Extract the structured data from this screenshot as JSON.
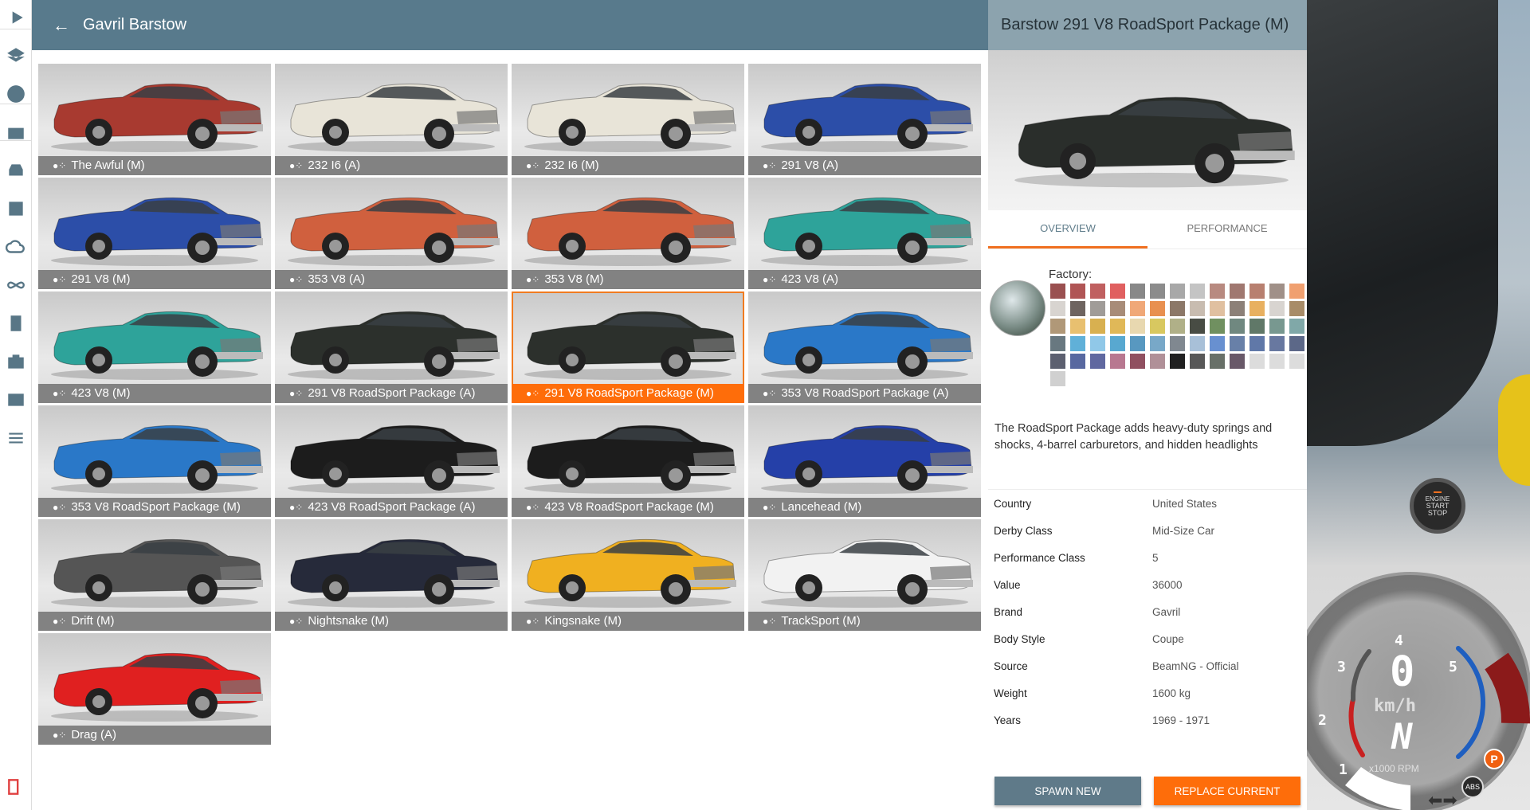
{
  "sidebar": {
    "items": [
      "play",
      "layers",
      "help",
      "scenarios",
      "vehicles",
      "vehicle-config",
      "cloud",
      "environment-infinity",
      "replay-film",
      "photo-camera",
      "ui-apps",
      "options-sliders",
      "exit"
    ]
  },
  "header": {
    "back_icon": "arrow-left-icon",
    "title": "Gavril Barstow"
  },
  "tiles": [
    {
      "label": "The Awful (M)",
      "color": "#a83a30"
    },
    {
      "label": "232 I6 (A)",
      "color": "#e8e4d8"
    },
    {
      "label": "232 I6 (M)",
      "color": "#e8e4d8"
    },
    {
      "label": "291 V8 (A)",
      "color": "#2c4ea8"
    },
    {
      "label": "291 V8 (M)",
      "color": "#2c4ea8"
    },
    {
      "label": "353 V8 (A)",
      "color": "#d0603e"
    },
    {
      "label": "353 V8 (M)",
      "color": "#d0603e"
    },
    {
      "label": "423 V8 (A)",
      "color": "#2ea39a"
    },
    {
      "label": "423 V8 (M)",
      "color": "#2ea39a"
    },
    {
      "label": "291 V8 RoadSport Package (A)",
      "color": "#2c302c"
    },
    {
      "label": "291 V8 RoadSport Package (M)",
      "color": "#2c302c",
      "selected": true
    },
    {
      "label": "353 V8 RoadSport Package (A)",
      "color": "#2a78c8"
    },
    {
      "label": "353 V8 RoadSport Package (M)",
      "color": "#2a78c8"
    },
    {
      "label": "423 V8 RoadSport Package (A)",
      "color": "#1c1c1c"
    },
    {
      "label": "423 V8 RoadSport Package (M)",
      "color": "#1c1c1c"
    },
    {
      "label": "Lancehead (M)",
      "color": "#2540a8"
    },
    {
      "label": "Drift (M)",
      "color": "#555555"
    },
    {
      "label": "Nightsnake (M)",
      "color": "#262a3a"
    },
    {
      "label": "Kingsnake (M)",
      "color": "#f0b020"
    },
    {
      "label": "TrackSport (M)",
      "color": "#f2f2f2"
    },
    {
      "label": "Drag (A)",
      "color": "#e02020"
    }
  ],
  "detail": {
    "title": "Barstow 291 V8 RoadSport Package (M)",
    "body_color": "#2a2e2b",
    "tabs": [
      "OVERVIEW",
      "PERFORMANCE"
    ],
    "paint_label": "Factory:",
    "swatches": [
      "#9a5050",
      "#b05555",
      "#c06060",
      "#e06060",
      "#888888",
      "#8c8c8c",
      "#a8a8a8",
      "#c4c4c4",
      "#b88a80",
      "#a07870",
      "#b88070",
      "#a09088",
      "#f0a070",
      "#d8d4d0",
      "#6e6460",
      "#a09c98",
      "#a88c78",
      "#f0a878",
      "#e89050",
      "#8c7868",
      "#c8bcb0",
      "#e0c0a0",
      "#8c8078",
      "#e8b060",
      "#d8d4d0",
      "#a88c68",
      "#b09878",
      "#e8c070",
      "#d8b050",
      "#e0b858",
      "#e8d8b0",
      "#d8c860",
      "#b0b088",
      "#484c44",
      "#709060",
      "#708880",
      "#607868",
      "#789890",
      "#80a8a8",
      "#687880",
      "#60b0d8",
      "#90c8e8",
      "#58a8d0",
      "#5898c0",
      "#78a8c8",
      "#808890",
      "#a8c0d8",
      "#6890d0",
      "#6880a8",
      "#6078a8",
      "#6878a0",
      "#5c6888",
      "#5c6070",
      "#5868a0",
      "#6068a0",
      "#b87890",
      "#905060",
      "#b09098",
      "#202020",
      "#585858",
      "#687068",
      "#685868",
      "#dcdcdc",
      "#dcdcdc",
      "#dcdcdc",
      "#d0d0d0"
    ],
    "description": "The RoadSport Package adds heavy-duty springs and shocks, 4-barrel carburetors, and hidden headlights",
    "specs": [
      {
        "k": "Country",
        "v": "United States"
      },
      {
        "k": "Derby Class",
        "v": "Mid-Size Car"
      },
      {
        "k": "Performance Class",
        "v": "5"
      },
      {
        "k": "Value",
        "v": "36000"
      },
      {
        "k": "Brand",
        "v": "Gavril"
      },
      {
        "k": "Body Style",
        "v": "Coupe"
      },
      {
        "k": "Source",
        "v": "BeamNG - Official"
      },
      {
        "k": "Weight",
        "v": "1600 kg"
      },
      {
        "k": "Years",
        "v": "1969 - 1971"
      }
    ],
    "spawn_label": "SPAWN NEW",
    "replace_label": "REPLACE CURRENT",
    "accent": "#fe6d0a",
    "secondary": "#5f7a89"
  },
  "hud": {
    "engine": [
      "ENGINE",
      "START",
      "STOP"
    ],
    "speed": "0",
    "unit": "km/h",
    "gear": "N",
    "rpm_label": "x1000 RPM",
    "ticks": [
      "1",
      "2",
      "3",
      "4",
      "5"
    ],
    "abs": "ABS",
    "parking": "P"
  }
}
